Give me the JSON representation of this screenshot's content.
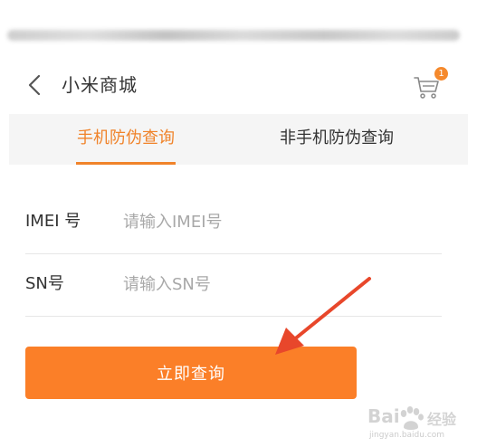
{
  "header": {
    "title": "小米商城",
    "cart_badge": "1"
  },
  "tabs": [
    {
      "label": "手机防伪查询",
      "active": true
    },
    {
      "label": "非手机防伪查询",
      "active": false
    }
  ],
  "form": {
    "imei": {
      "label": "IMEI 号",
      "placeholder": "请输入IMEI号",
      "value": ""
    },
    "sn": {
      "label": "SN号",
      "placeholder": "请输入SN号",
      "value": ""
    }
  },
  "submit_label": "立即查询",
  "watermark": {
    "brand": "Bai",
    "suffix": "经验",
    "url": "jingyan.baidu.com"
  },
  "colors": {
    "accent": "#f0832a",
    "button": "#fb7f28",
    "annotation_arrow": "#e8472b",
    "tab_bar_bg": "#f5f5f5"
  },
  "icons": {
    "back": "chevron-left-icon",
    "cart": "shopping-cart-icon",
    "annotation": "red-arrow-icon",
    "watermark": "baidu-paw-icon"
  }
}
